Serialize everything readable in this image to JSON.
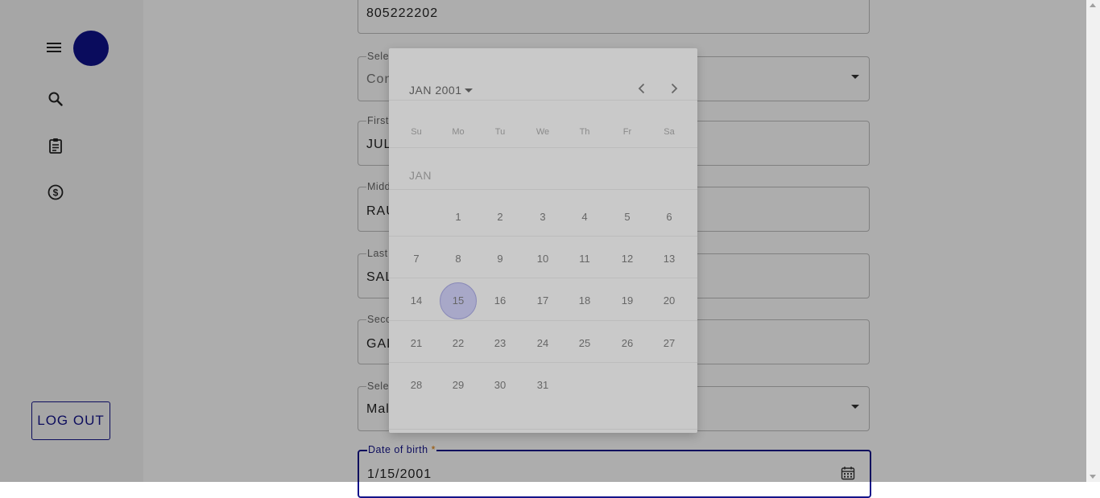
{
  "sidebar": {
    "logout_label": "LOG OUT",
    "icons": [
      "menu-icon",
      "search-icon",
      "clipboard-icon",
      "dollar-circle-icon"
    ]
  },
  "form": {
    "phone_value": "805222202",
    "credit_line": {
      "label": "Select credit line type",
      "value": "Consumer credit line"
    },
    "first_name": {
      "label": "First name",
      "required": "*",
      "value": "JULIO"
    },
    "middle_name": {
      "label": "Middle name",
      "value": "RAUL"
    },
    "last_name": {
      "label": "Last name",
      "required": "*",
      "value": "SALINAS"
    },
    "second_last_name": {
      "label": "Second last name",
      "value": "GALVEZ"
    },
    "gender": {
      "label": "Select gender",
      "required": "*",
      "value": "Male"
    },
    "dob": {
      "label": "Date of birth",
      "required": "*",
      "value": "1/15/2001"
    }
  },
  "datepicker": {
    "header": "JAN 2001",
    "weekdays": [
      "Su",
      "Mo",
      "Tu",
      "We",
      "Th",
      "Fr",
      "Sa"
    ],
    "month_label": "JAN",
    "selected_day": "15",
    "weeks": [
      [
        "",
        "1",
        "2",
        "3",
        "4",
        "5",
        "6"
      ],
      [
        "7",
        "8",
        "9",
        "10",
        "11",
        "12",
        "13"
      ],
      [
        "14",
        "15",
        "16",
        "17",
        "18",
        "19",
        "20"
      ],
      [
        "21",
        "22",
        "23",
        "24",
        "25",
        "26",
        "27"
      ],
      [
        "28",
        "29",
        "30",
        "31",
        "",
        "",
        ""
      ]
    ]
  },
  "colors": {
    "primary": "#14148a",
    "avatar": "#10128a",
    "required": "#e07b00",
    "overlay": "rgba(0,0,0,0.32)"
  }
}
